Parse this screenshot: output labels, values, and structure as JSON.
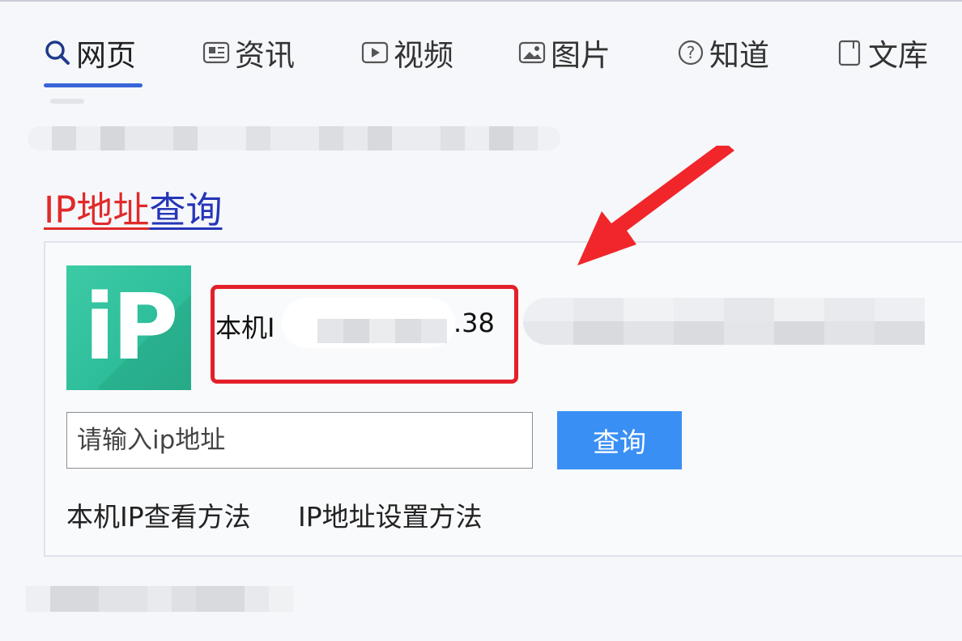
{
  "tabs": [
    {
      "label": "网页",
      "icon": "search-icon",
      "active": true
    },
    {
      "label": "资讯",
      "icon": "news-icon",
      "active": false
    },
    {
      "label": "视频",
      "icon": "video-icon",
      "active": false
    },
    {
      "label": "图片",
      "icon": "image-icon",
      "active": false
    },
    {
      "label": "知道",
      "icon": "question-icon",
      "active": false
    },
    {
      "label": "文库",
      "icon": "document-icon",
      "active": false
    }
  ],
  "result": {
    "title_part1": "IP地址",
    "title_part2": "查询",
    "logo_text": "iP",
    "ip_prefix": "本机I",
    "ip_suffix": ".38"
  },
  "search": {
    "placeholder": "请输入ip地址",
    "button_label": "查询"
  },
  "links": {
    "view_method": "本机IP查看方法",
    "set_method": "IP地址设置方法"
  },
  "colors": {
    "accent_blue": "#3766d8",
    "button_blue": "#3a8ff5",
    "title_red": "#e02a2a",
    "title_blue": "#2535b8",
    "highlight_red": "#e3202a",
    "logo_green": "#33c4a0"
  }
}
